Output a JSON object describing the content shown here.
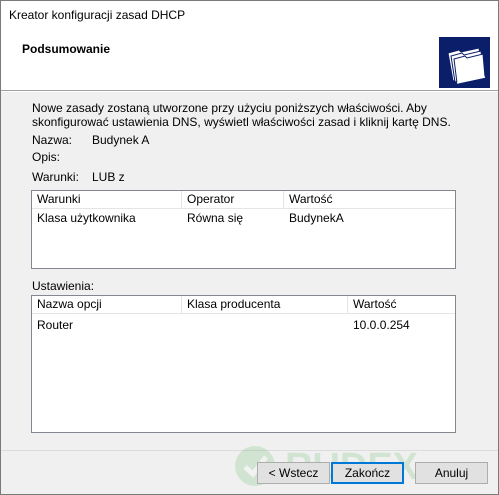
{
  "window": {
    "title": "Kreator konfiguracji zasad DHCP"
  },
  "header": {
    "heading": "Podsumowanie",
    "logo_icon": "folders-icon",
    "logo_bg": "#0a1e6a"
  },
  "description": "Nowe zasady zostaną utworzone przy użyciu poniższych właściwości. Aby skonfigurować ustawienia DNS, wyświetl właściwości zasad i kliknij kartę DNS.",
  "fields": {
    "name_label": "Nazwa:",
    "name_value": "Budynek A",
    "desc_label": "Opis:",
    "desc_value": "",
    "cond_label": "Warunki:",
    "cond_value": "LUB z"
  },
  "conditions_table": {
    "columns": [
      "Warunki",
      "Operator",
      "Wartość"
    ],
    "rows": [
      [
        "Klasa użytkownika",
        "Równa się",
        "BudynekA"
      ]
    ]
  },
  "settings": {
    "label": "Ustawienia:",
    "columns": [
      "Nazwa opcji",
      "Klasa producenta",
      "Wartość"
    ],
    "rows": [
      [
        "Router",
        "",
        "10.0.0.254"
      ]
    ]
  },
  "buttons": {
    "back": "< Wstecz",
    "finish": "Zakończ",
    "cancel": "Anuluj"
  },
  "watermark": "RUDEX"
}
